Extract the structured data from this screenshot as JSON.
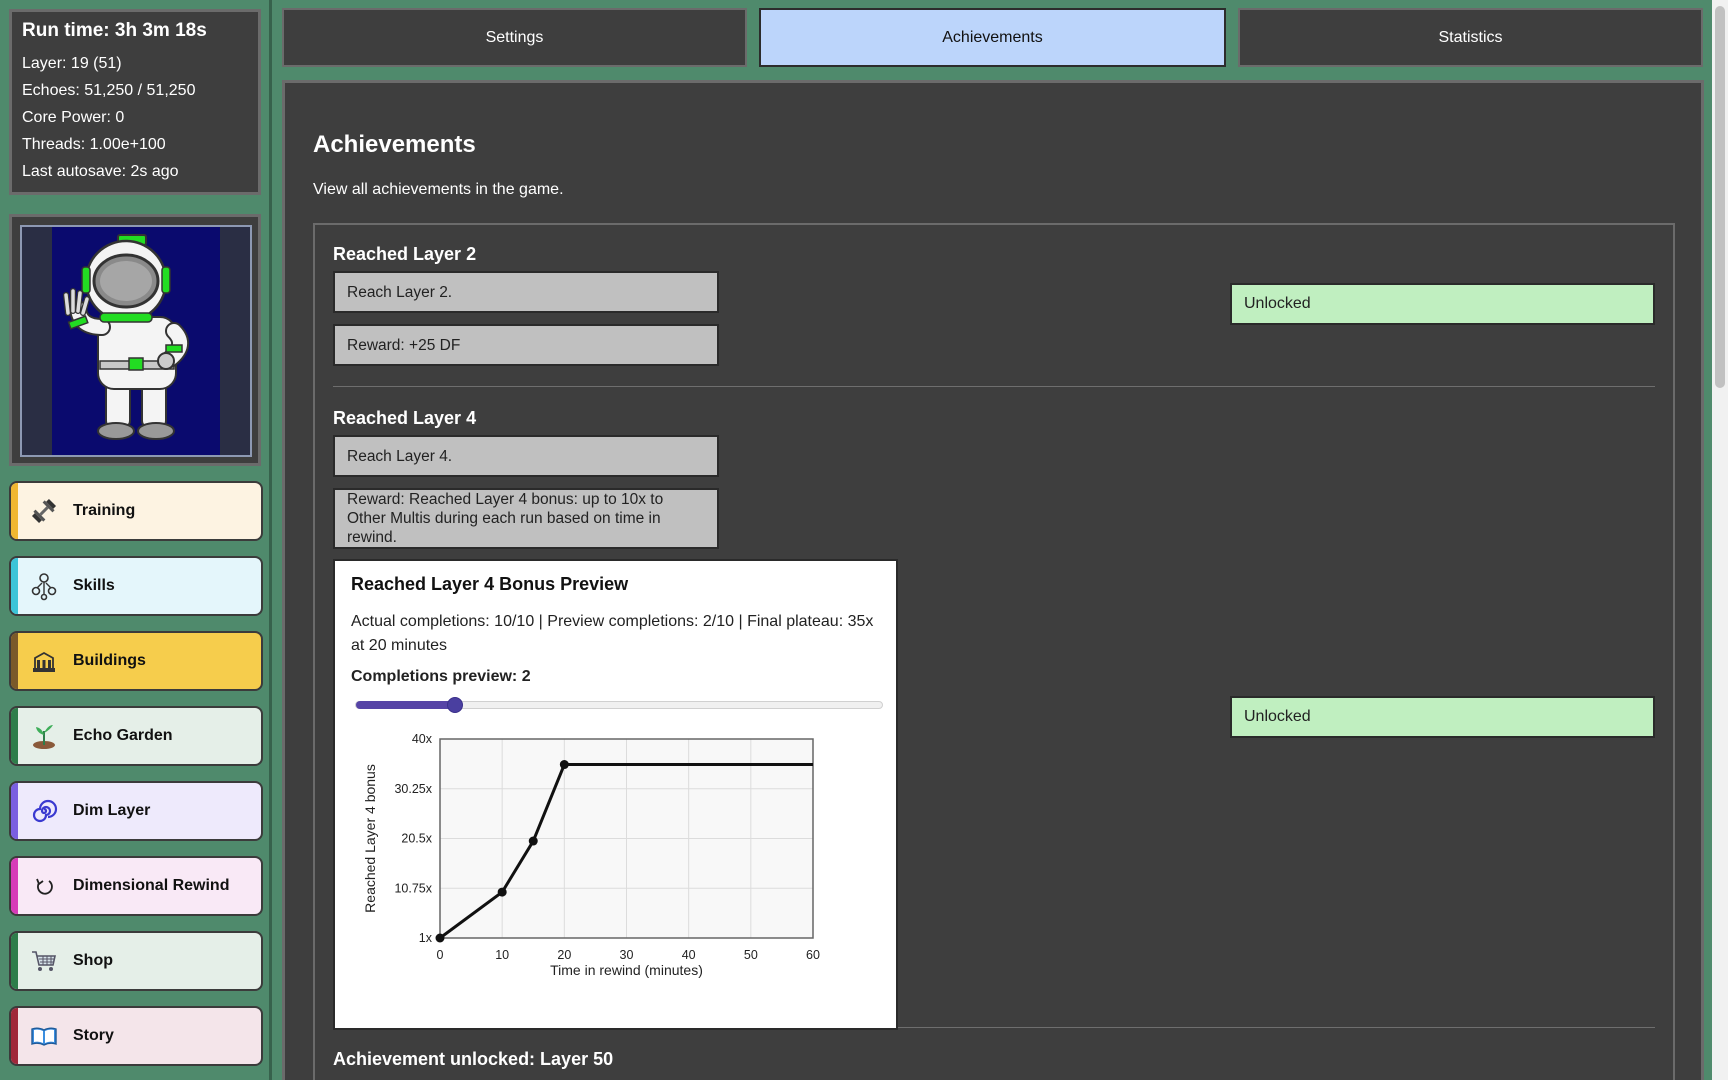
{
  "stats": {
    "runtime": "Run time: 3h 3m 18s",
    "layer": "Layer: 19 (51)",
    "echoes": "Echoes: 51,250 / 51,250",
    "core_power": "Core Power: 0",
    "threads": "Threads: 1.00e+100",
    "autosave": "Last autosave: 2s ago"
  },
  "nav": [
    {
      "label": "Training",
      "icon": "dumbbell-icon",
      "bg": "#fdf3e2",
      "stripe": "#f0b732"
    },
    {
      "label": "Skills",
      "icon": "skills-tree-icon",
      "bg": "#e4f6fb",
      "stripe": "#3cc4d8"
    },
    {
      "label": "Buildings",
      "icon": "building-icon",
      "bg": "#f6cd4c",
      "stripe": "#7a5a2a"
    },
    {
      "label": "Echo Garden",
      "icon": "sprout-icon",
      "bg": "#e5efe8",
      "stripe": "#2e7d4a"
    },
    {
      "label": "Dim Layer",
      "icon": "spiral-icon",
      "bg": "#eeeafc",
      "stripe": "#7a5fe0"
    },
    {
      "label": "Dimensional Rewind",
      "icon": "rewind-icon",
      "bg": "#f9e9f6",
      "stripe": "#d63bb8"
    },
    {
      "label": "Shop",
      "icon": "cart-icon",
      "bg": "#e5efe8",
      "stripe": "#2e7d4a"
    },
    {
      "label": "Story",
      "icon": "book-icon",
      "bg": "#f4e5ea",
      "stripe": "#a0283a"
    }
  ],
  "tabs": [
    "Settings",
    "Achievements",
    "Statistics"
  ],
  "page": {
    "title": "Achievements",
    "description": "View all achievements in the game."
  },
  "achievements": [
    {
      "title": "Reached Layer 2",
      "requirement": "Reach Layer 2.",
      "reward": "Reward: +25 DF",
      "status": "Unlocked"
    },
    {
      "title": "Reached Layer 4",
      "requirement": "Reach Layer 4.",
      "reward": "Reward: Reached Layer 4 bonus: up to 10x to Other Multis during each run based on time in rewind.",
      "status": "Unlocked"
    },
    {
      "title": "Achievement unlocked: Layer 50"
    }
  ],
  "preview": {
    "title": "Reached Layer 4 Bonus Preview",
    "info": "Actual completions: 10/10 | Preview completions: 2/10 | Final plateau: 35x at 20 minutes",
    "completions_label": "Completions preview: 2",
    "slider_value": 2,
    "slider_max": 10
  },
  "chart_data": {
    "type": "line",
    "xlabel": "Time in rewind (minutes)",
    "ylabel": "Reached Layer 4 bonus",
    "x_ticks": [
      "0",
      "10",
      "20",
      "30",
      "40",
      "50",
      "60"
    ],
    "y_ticks": [
      "1x",
      "10.75x",
      "20.5x",
      "30.25x",
      "40x"
    ],
    "xlim": [
      0,
      60
    ],
    "ylim": [
      1,
      40
    ],
    "grid": true,
    "series": [
      {
        "x": [
          0,
          10,
          15,
          20,
          60
        ],
        "y": [
          1,
          10,
          20,
          35,
          35
        ],
        "markers": [
          0,
          10,
          15,
          20
        ]
      }
    ]
  },
  "colors": {
    "background": "#4f8a6c",
    "panel": "#3e3e3e",
    "active_tab": "#bcd5fb",
    "unlocked": "#c0efc0",
    "slider": "#5644a6"
  }
}
